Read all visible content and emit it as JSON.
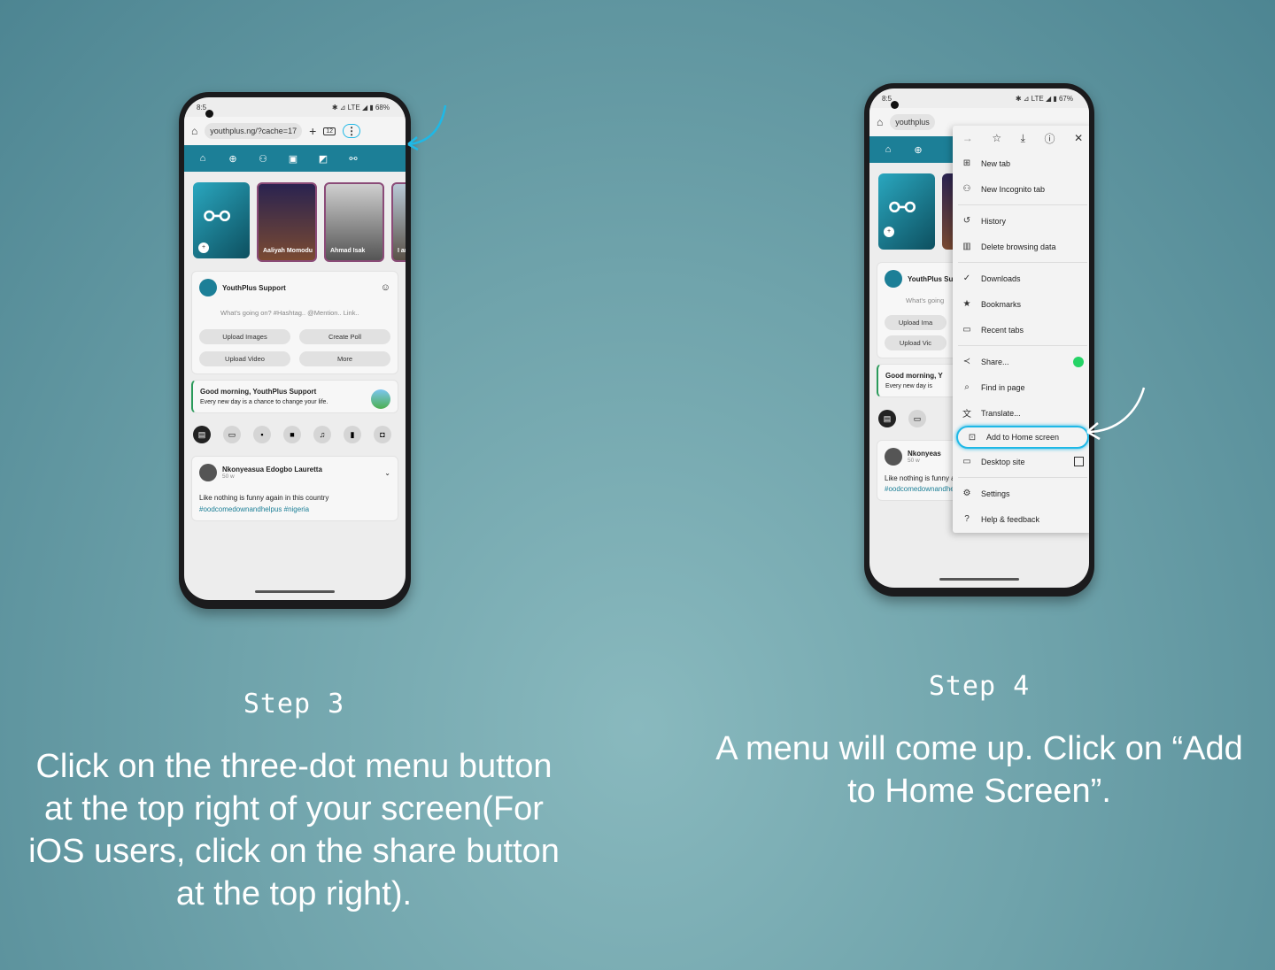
{
  "left_phone": {
    "status_time": "8:5",
    "status_right": "✱ ⊿ LTE ◢ ▮ 68%",
    "url": "youthplus.ng/?cache=17",
    "tab_count": "12",
    "stories": [
      {
        "label": ""
      },
      {
        "label": "Aaliyah Momodu"
      },
      {
        "label": "Ahmad Isak"
      },
      {
        "label": "I am T"
      }
    ],
    "composer": {
      "name": "YouthPlus Support",
      "placeholder": "What's going on? #Hashtag.. @Mention.. Link..",
      "buttons": [
        "Upload Images",
        "Create Poll",
        "Upload Video",
        "More"
      ]
    },
    "greeting": {
      "title": "Good morning, YouthPlus Support",
      "subtitle": "Every new day is a chance to change your life."
    },
    "post": {
      "author": "Nkonyeasua Edogbo Lauretta",
      "time": "50 w",
      "text": "Like nothing is funny again in this country",
      "tags": "#oodcomedownandhelpus #nigeria"
    }
  },
  "right_phone": {
    "status_time": "8:5",
    "status_right": "✱ ⊿ LTE ◢ ▮ 67%",
    "url": "youthplus",
    "composer_name": "YouthPlus Su",
    "placeholder": "What's going",
    "btn1": "Upload Ima",
    "btn2": "Upload Vic",
    "greeting_title": "Good morning, Y",
    "greeting_sub": "Every new day is",
    "post_author": "Nkonyeas",
    "post_time": "50 w",
    "post_text": "Like nothing is funny again in this country",
    "post_tags": "#oodcomedownandhelpus #nigeria",
    "menu": [
      {
        "label": "New tab",
        "icon": "plus-box-icon"
      },
      {
        "label": "New Incognito tab",
        "icon": "incognito-icon"
      },
      {
        "label": "History",
        "icon": "history-icon"
      },
      {
        "label": "Delete browsing data",
        "icon": "trash-icon"
      },
      {
        "label": "Downloads",
        "icon": "download-check-icon"
      },
      {
        "label": "Bookmarks",
        "icon": "star-icon"
      },
      {
        "label": "Recent tabs",
        "icon": "devices-icon"
      },
      {
        "label": "Share...",
        "icon": "share-icon"
      },
      {
        "label": "Find in page",
        "icon": "find-icon"
      },
      {
        "label": "Translate...",
        "icon": "translate-icon"
      },
      {
        "label": "Add to Home screen",
        "icon": "add-home-icon"
      },
      {
        "label": "Desktop site",
        "icon": "desktop-icon"
      },
      {
        "label": "Settings",
        "icon": "gear-icon"
      },
      {
        "label": "Help & feedback",
        "icon": "help-icon"
      }
    ]
  },
  "steps": {
    "step3_title": "Step 3",
    "step3_text": "Click on the three-dot menu button at the top right of your screen(For iOS users, click on the share button at the top right).",
    "step4_title": "Step 4",
    "step4_text": "A menu will come up. Click on “Add to Home Screen”."
  },
  "colors": {
    "accent": "#1c7f97",
    "annotation": "#1fb8e6"
  }
}
